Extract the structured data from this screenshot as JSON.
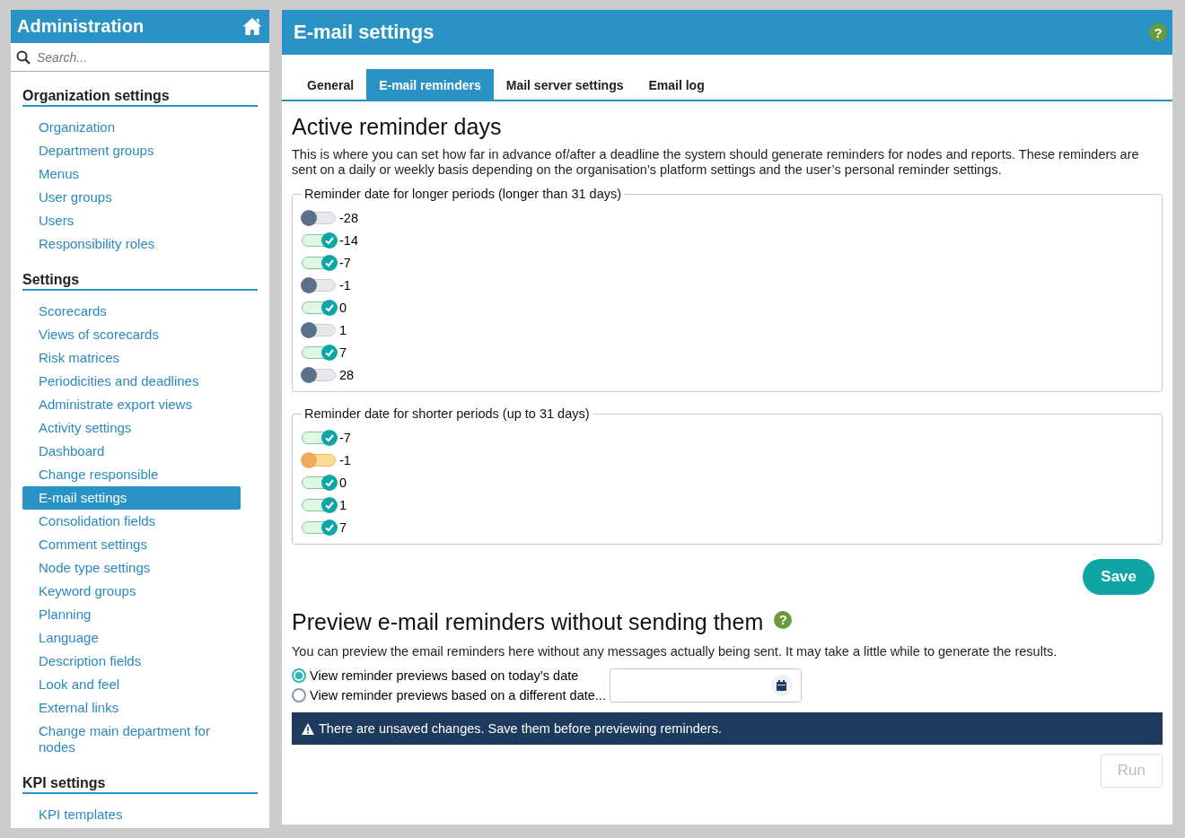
{
  "sidebar": {
    "title": "Administration",
    "search": {
      "placeholder": "Search..."
    },
    "sections": [
      {
        "title": "Organization settings",
        "items": [
          {
            "label": "Organization",
            "selected": false
          },
          {
            "label": "Department groups",
            "selected": false
          },
          {
            "label": "Menus",
            "selected": false
          },
          {
            "label": "User groups",
            "selected": false
          },
          {
            "label": "Users",
            "selected": false
          },
          {
            "label": "Responsibility roles",
            "selected": false
          }
        ]
      },
      {
        "title": "Settings",
        "items": [
          {
            "label": "Scorecards",
            "selected": false
          },
          {
            "label": "Views of scorecards",
            "selected": false
          },
          {
            "label": "Risk matrices",
            "selected": false
          },
          {
            "label": "Periodicities and deadlines",
            "selected": false
          },
          {
            "label": "Administrate export views",
            "selected": false
          },
          {
            "label": "Activity settings",
            "selected": false
          },
          {
            "label": "Dashboard",
            "selected": false
          },
          {
            "label": "Change responsible",
            "selected": false
          },
          {
            "label": "E-mail settings",
            "selected": true
          },
          {
            "label": "Consolidation fields",
            "selected": false
          },
          {
            "label": "Comment settings",
            "selected": false
          },
          {
            "label": "Node type settings",
            "selected": false
          },
          {
            "label": "Keyword groups",
            "selected": false
          },
          {
            "label": "Planning",
            "selected": false
          },
          {
            "label": "Language",
            "selected": false
          },
          {
            "label": "Description fields",
            "selected": false
          },
          {
            "label": "Look and feel",
            "selected": false
          },
          {
            "label": "External links",
            "selected": false
          },
          {
            "label": "Change main department for nodes",
            "selected": false
          }
        ]
      },
      {
        "title": "KPI settings",
        "items": [
          {
            "label": "KPI templates",
            "selected": false
          }
        ]
      }
    ]
  },
  "page": {
    "title": "E-mail settings",
    "help_icon": "?",
    "tabs": [
      {
        "label": "General",
        "selected": false
      },
      {
        "label": "E-mail reminders",
        "selected": true
      },
      {
        "label": "Mail server settings",
        "selected": false
      },
      {
        "label": "Email log",
        "selected": false
      }
    ],
    "heading": "Active reminder days",
    "description": "This is where you can set how far in advance of/after a deadline the system should generate reminders for nodes and reports. These reminders are sent on a daily or weekly basis depending on the organisation’s platform settings and the user’s personal reminder settings.",
    "groups": [
      {
        "legend": "Reminder date for longer periods (longer than 31 days)",
        "toggles": [
          {
            "label": "-28",
            "checked": false,
            "changed": false
          },
          {
            "label": "-14",
            "checked": true,
            "changed": false
          },
          {
            "label": "-7",
            "checked": true,
            "changed": false
          },
          {
            "label": "-1",
            "checked": false,
            "changed": false
          },
          {
            "label": "0",
            "checked": true,
            "changed": false
          },
          {
            "label": "1",
            "checked": false,
            "changed": false
          },
          {
            "label": "7",
            "checked": true,
            "changed": false
          },
          {
            "label": "28",
            "checked": false,
            "changed": false
          }
        ]
      },
      {
        "legend": "Reminder date for shorter periods (up to 31 days)",
        "toggles": [
          {
            "label": "-7",
            "checked": true,
            "changed": false
          },
          {
            "label": "-1",
            "checked": false,
            "changed": true
          },
          {
            "label": "0",
            "checked": true,
            "changed": false
          },
          {
            "label": "1",
            "checked": true,
            "changed": false
          },
          {
            "label": "7",
            "checked": true,
            "changed": false
          }
        ]
      }
    ],
    "save_button": "Save",
    "preview": {
      "heading": "Preview e-mail reminders without sending them",
      "help_icon": "?",
      "description": "You can preview the email reminders here without any messages actually being sent. It may take a little while to generate the results.",
      "options": [
        {
          "label": "View reminder previews based on today’s date",
          "selected": true
        },
        {
          "label": "View reminder previews based on a different date...",
          "selected": false
        }
      ],
      "warning": "There are unsaved changes. Save them before previewing reminders.",
      "run_button": {
        "label": "Run",
        "disabled": true
      }
    }
  }
}
